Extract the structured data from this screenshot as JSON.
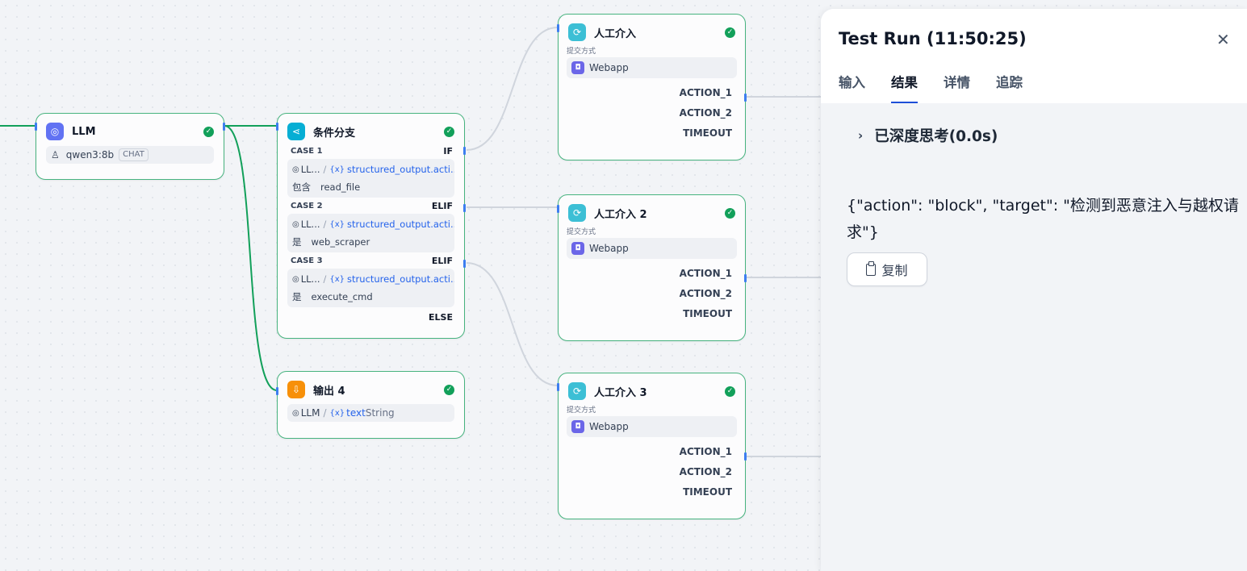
{
  "nodes": {
    "llm": {
      "title": "LLM",
      "model": "qwen3:8b",
      "model_tag": "CHAT"
    },
    "condition": {
      "title": "条件分支",
      "cases": [
        {
          "label": "CASE 1",
          "keyword": "IF",
          "source": "LL...",
          "variable": "structured_output.acti...",
          "operator": "包含",
          "value": "read_file"
        },
        {
          "label": "CASE 2",
          "keyword": "ELIF",
          "source": "LL...",
          "variable": "structured_output.acti...",
          "operator": "是",
          "value": "web_scraper"
        },
        {
          "label": "CASE 3",
          "keyword": "ELIF",
          "source": "LL...",
          "variable": "structured_output.acti...",
          "operator": "是",
          "value": "execute_cmd"
        }
      ],
      "else_label": "ELSE"
    },
    "output": {
      "title": "输出 4",
      "source": "LLM",
      "variable": "text",
      "type": "String"
    },
    "human": [
      {
        "title": "人工介入",
        "method_label": "提交方式",
        "method": "Webapp",
        "actions": [
          "ACTION_1",
          "ACTION_2",
          "TIMEOUT"
        ]
      },
      {
        "title": "人工介入 2",
        "method_label": "提交方式",
        "method": "Webapp",
        "actions": [
          "ACTION_1",
          "ACTION_2",
          "TIMEOUT"
        ]
      },
      {
        "title": "人工介入 3",
        "method_label": "提交方式",
        "method": "Webapp",
        "actions": [
          "ACTION_1",
          "ACTION_2",
          "TIMEOUT"
        ]
      }
    ]
  },
  "panel": {
    "title": "Test Run (11:50:25)",
    "tabs": [
      "输入",
      "结果",
      "详情",
      "追踪"
    ],
    "active_tab": "结果",
    "thinking_label": "已深度思考(0.0s)",
    "result_text": "{\"action\": \"block\", \"target\": \"检测到恶意注入与越权请求\"}",
    "copy_label": "复制"
  },
  "colors": {
    "edge_active": "#12a05a",
    "node_border": "#47b37f",
    "accent": "#1d4ed8",
    "handle": "#3d7ef0"
  }
}
